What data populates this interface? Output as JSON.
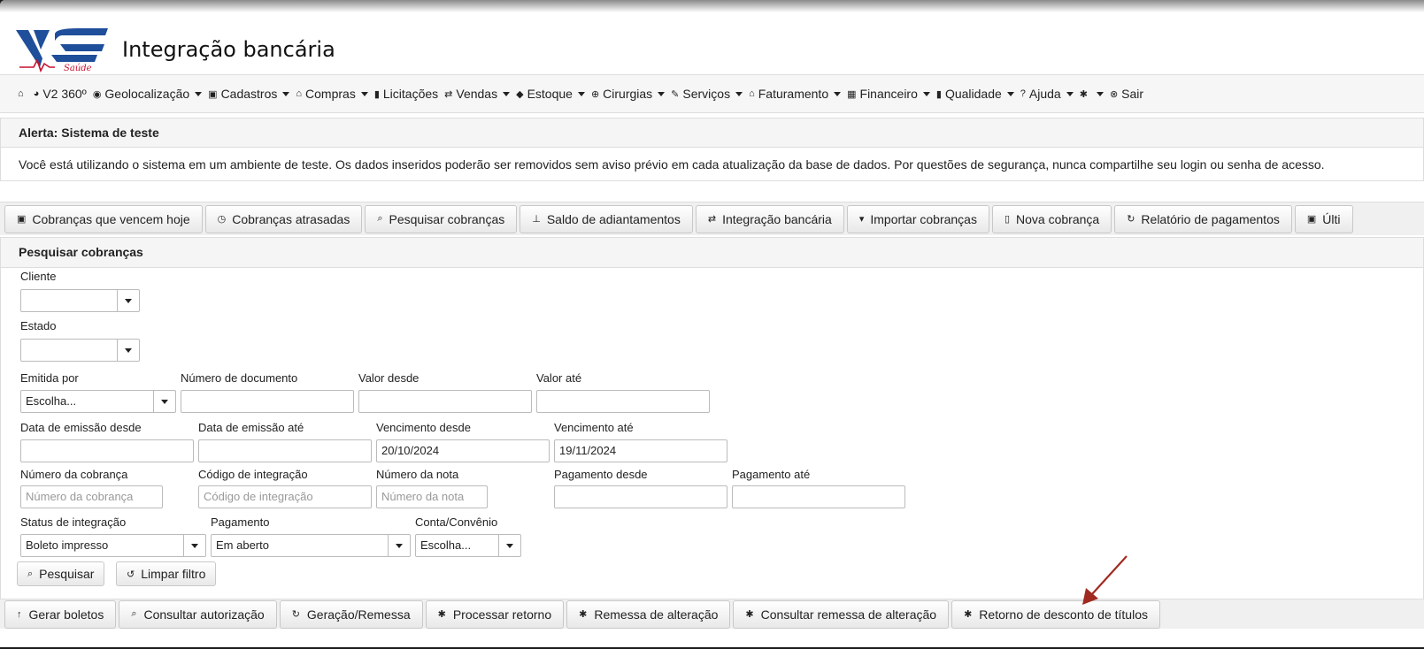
{
  "app": {
    "title": "Integração bancária"
  },
  "logo": {
    "text": "Saúde"
  },
  "nav": [
    {
      "icon": "home-icon",
      "glyph": "⌂",
      "label": "",
      "dropdown": false
    },
    {
      "icon": "pie-chart-icon",
      "glyph": "◕",
      "label": "V2 360º",
      "dropdown": false
    },
    {
      "icon": "globe-icon",
      "glyph": "◉",
      "label": "Geolocalização",
      "dropdown": true
    },
    {
      "icon": "floppy-icon",
      "glyph": "▣",
      "label": "Cadastros",
      "dropdown": true
    },
    {
      "icon": "bank-icon",
      "glyph": "⌂",
      "label": "Compras",
      "dropdown": true
    },
    {
      "icon": "book-icon",
      "glyph": "▮",
      "label": "Licitações",
      "dropdown": false
    },
    {
      "icon": "transfer-icon",
      "glyph": "⇄",
      "label": "Vendas",
      "dropdown": true
    },
    {
      "icon": "tag-icon",
      "glyph": "◆",
      "label": "Estoque",
      "dropdown": true
    },
    {
      "icon": "plus-circle-icon",
      "glyph": "⊕",
      "label": "Cirurgias",
      "dropdown": true
    },
    {
      "icon": "wrench-icon",
      "glyph": "✎",
      "label": "Serviços",
      "dropdown": true
    },
    {
      "icon": "bank-icon",
      "glyph": "⌂",
      "label": "Faturamento",
      "dropdown": true
    },
    {
      "icon": "calculator-icon",
      "glyph": "▦",
      "label": "Financeiro",
      "dropdown": true
    },
    {
      "icon": "book-icon",
      "glyph": "▮",
      "label": "Qualidade",
      "dropdown": true
    },
    {
      "icon": "question-icon",
      "glyph": "?",
      "label": "Ajuda",
      "dropdown": true
    },
    {
      "icon": "gear-icon",
      "glyph": "✱",
      "label": "",
      "dropdown": true
    },
    {
      "icon": "close-circle-icon",
      "glyph": "⊗",
      "label": "Sair",
      "dropdown": false
    }
  ],
  "alert": {
    "title": "Alerta: Sistema de teste",
    "message": "Você está utilizando o sistema em um ambiente de teste. Os dados inseridos poderão ser removidos sem aviso prévio em cada atualização da base de dados. Por questões de segurança, nunca compartilhe seu login ou senha de acesso."
  },
  "tabs": [
    {
      "icon": "calendar-icon",
      "glyph": "▣",
      "label": "Cobranças que vencem hoje"
    },
    {
      "icon": "clock-icon",
      "glyph": "◷",
      "label": "Cobranças atrasadas"
    },
    {
      "icon": "search-icon",
      "glyph": "⌕",
      "label": "Pesquisar cobranças"
    },
    {
      "icon": "pushpin-icon",
      "glyph": "⊥",
      "label": "Saldo de adiantamentos"
    },
    {
      "icon": "transfer-icon",
      "glyph": "⇄",
      "label": "Integração bancária"
    },
    {
      "icon": "caret-down-icon",
      "glyph": "▾",
      "label": "Importar cobranças"
    },
    {
      "icon": "file-icon",
      "glyph": "▯",
      "label": "Nova cobrança"
    },
    {
      "icon": "refresh-icon",
      "glyph": "↻",
      "label": "Relatório de pagamentos"
    },
    {
      "icon": "calendar-icon",
      "glyph": "▣",
      "label": "Últi"
    }
  ],
  "search_panel": {
    "title": "Pesquisar cobranças",
    "fields": {
      "cliente": {
        "label": "Cliente",
        "value": ""
      },
      "estado": {
        "label": "Estado",
        "value": ""
      },
      "emitida_por": {
        "label": "Emitida por",
        "value": "Escolha..."
      },
      "numero_documento": {
        "label": "Número de documento",
        "value": ""
      },
      "valor_desde": {
        "label": "Valor desde",
        "value": ""
      },
      "valor_ate": {
        "label": "Valor até",
        "value": ""
      },
      "data_emissao_desde": {
        "label": "Data de emissão desde",
        "value": ""
      },
      "data_emissao_ate": {
        "label": "Data de emissão até",
        "value": ""
      },
      "vencimento_desde": {
        "label": "Vencimento desde",
        "value": "20/10/2024"
      },
      "vencimento_ate": {
        "label": "Vencimento até",
        "value": "19/11/2024"
      },
      "numero_cobranca": {
        "label": "Número da cobrança",
        "placeholder": "Número da cobrança"
      },
      "codigo_integracao": {
        "label": "Código de integração",
        "placeholder": "Código de integração"
      },
      "numero_nota": {
        "label": "Número da nota",
        "placeholder": "Número da nota"
      },
      "pagamento_desde": {
        "label": "Pagamento desde",
        "value": ""
      },
      "pagamento_ate": {
        "label": "Pagamento até",
        "value": ""
      },
      "status_integracao": {
        "label": "Status de integração",
        "value": "Boleto impresso"
      },
      "pagamento": {
        "label": "Pagamento",
        "value": "Em aberto"
      },
      "conta_convenio": {
        "label": "Conta/Convênio",
        "value": "Escolha..."
      }
    },
    "buttons": {
      "pesquisar": {
        "glyph": "⌕",
        "label": "Pesquisar"
      },
      "limpar": {
        "glyph": "↺",
        "label": "Limpar filtro"
      }
    }
  },
  "bottom_actions": [
    {
      "icon": "upload-icon",
      "glyph": "↑",
      "label": "Gerar boletos"
    },
    {
      "icon": "search-icon",
      "glyph": "⌕",
      "label": "Consultar autorização"
    },
    {
      "icon": "refresh-icon",
      "glyph": "↻",
      "label": "Geração/Remessa"
    },
    {
      "icon": "gear-icon",
      "glyph": "✱",
      "label": "Processar retorno"
    },
    {
      "icon": "gear-icon",
      "glyph": "✱",
      "label": "Remessa de alteração"
    },
    {
      "icon": "gear-icon",
      "glyph": "✱",
      "label": "Consultar remessa de alteração"
    },
    {
      "icon": "gear-icon",
      "glyph": "✱",
      "label": "Retorno de desconto de títulos"
    }
  ],
  "colors": {
    "logo_blue": "#1f4e9a",
    "annotation_arrow": "#a02a20"
  }
}
